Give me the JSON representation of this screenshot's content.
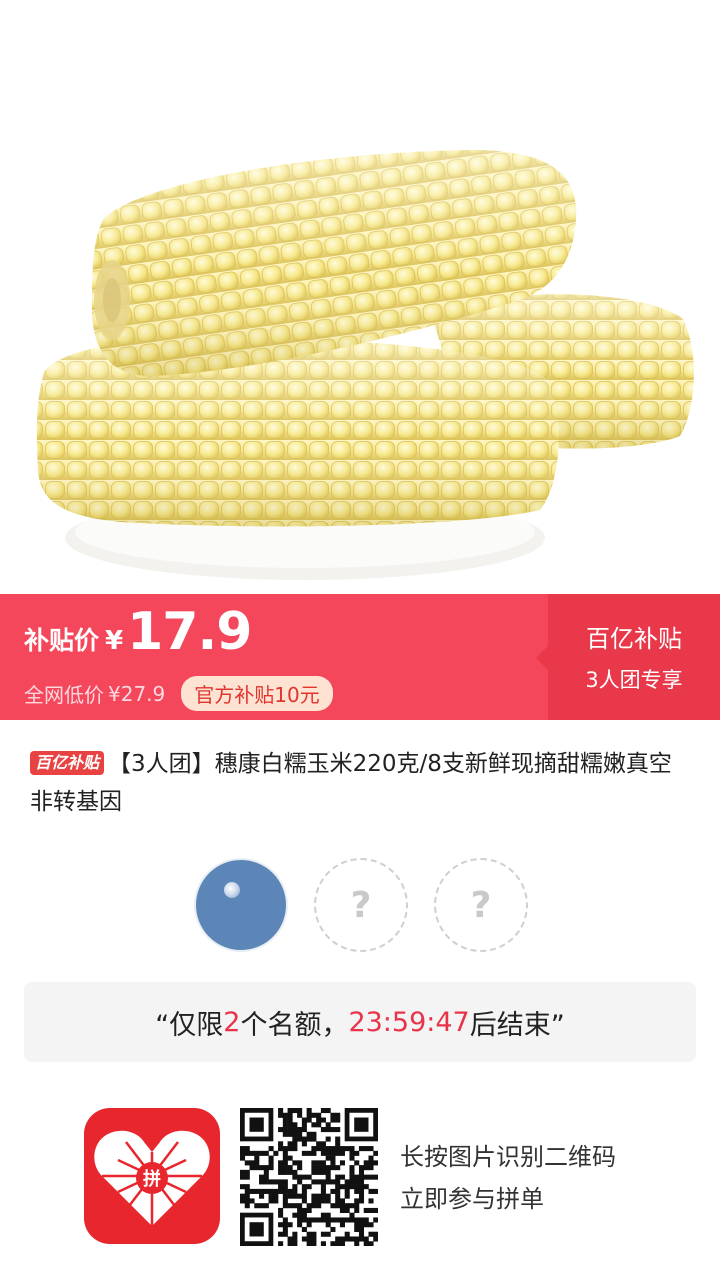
{
  "product": {
    "image_alt": "糯玉米",
    "title_tag": "百亿补贴",
    "title": "【3人团】穗康白糯玉米220克/8支新鲜现摘甜糯嫩真空非转基因"
  },
  "price": {
    "label": "补贴价",
    "currency": "¥",
    "value": "17.9",
    "market_label": "全网低价",
    "market_price": "¥27.9",
    "subsidy_badge": "官方补贴10元",
    "side_title": "百亿补贴",
    "side_subtitle": "3人团专享"
  },
  "group": {
    "empty_slot_mark": "?",
    "notice_prefix": "“仅限",
    "slots_left": "2",
    "notice_mid": "个名额，",
    "countdown": "23:59:47",
    "notice_suffix": "后结束”"
  },
  "footer": {
    "app_logo_char": "拼",
    "scan_line1": "长按图片识别二维码",
    "scan_line2": "立即参与拼单"
  },
  "colors": {
    "brand_red": "#e8262e",
    "price_red": "#f5475c",
    "avatar_blue": "#5d86b8"
  }
}
